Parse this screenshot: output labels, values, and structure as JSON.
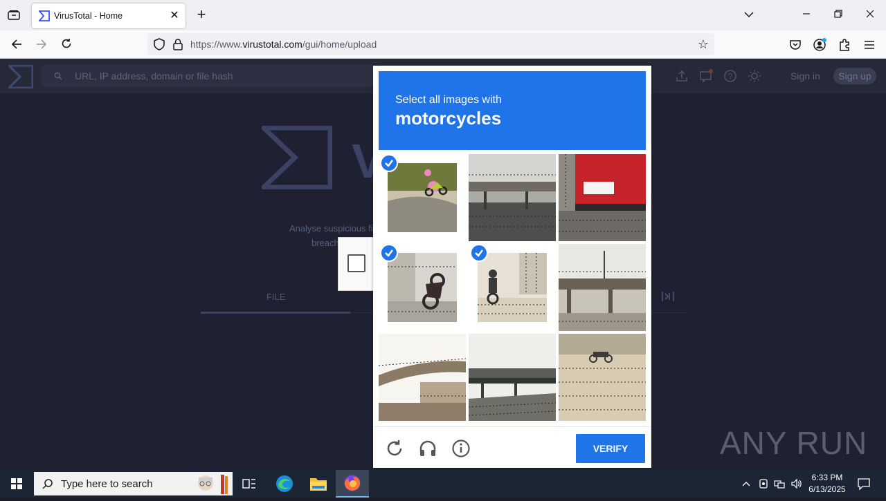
{
  "browser": {
    "tab_title": "VirusTotal - Home",
    "url_prefix": "https://www.",
    "url_domain": "virustotal.com",
    "url_path": "/gui/home/upload"
  },
  "virustotal": {
    "search_placeholder": "URL, IP address, domain or file hash",
    "sign_in": "Sign in",
    "sign_up": "Sign up",
    "description_line1": "Analyse suspicious fi",
    "description_line2": "breach",
    "logo_partial": "V",
    "file_tab": "FILE"
  },
  "captcha": {
    "prompt": "Select all images with",
    "target": "motorcycles",
    "verify_label": "VERIFY",
    "tiles": [
      {
        "id": 1,
        "selected": true
      },
      {
        "id": 2,
        "selected": false
      },
      {
        "id": 3,
        "selected": false
      },
      {
        "id": 4,
        "selected": true
      },
      {
        "id": 5,
        "selected": true
      },
      {
        "id": 6,
        "selected": false
      },
      {
        "id": 7,
        "selected": false
      },
      {
        "id": 8,
        "selected": false
      },
      {
        "id": 9,
        "selected": false
      }
    ],
    "accent_color": "#1e74e8"
  },
  "watermark": "ANY RUN",
  "taskbar": {
    "search_placeholder": "Type here to search",
    "time": "6:33 PM",
    "date": "6/13/2025"
  }
}
